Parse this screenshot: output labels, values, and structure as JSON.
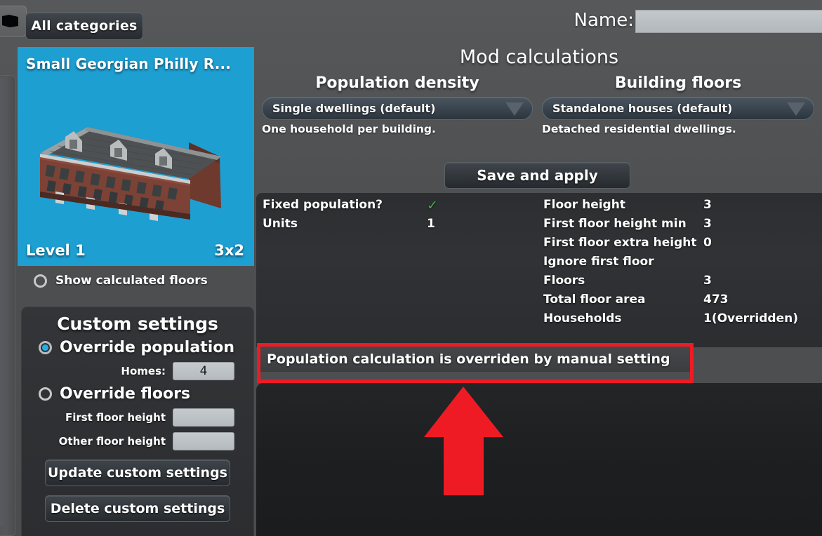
{
  "toolbar": {
    "folder_icon": "folder-icon",
    "all_categories_label": "All categories"
  },
  "name_row": {
    "label": "Name:",
    "value": "",
    "placeholder": ""
  },
  "asset_card": {
    "title": "Small Georgian Philly R...",
    "level": "Level 1",
    "size": "3x2",
    "thumb_bg": "#1e9fd2"
  },
  "show_calculated_floors": {
    "label": "Show calculated floors",
    "selected": false
  },
  "custom_settings": {
    "title": "Custom settings",
    "override_population_label": "Override population",
    "override_population_selected": true,
    "homes_label": "Homes:",
    "homes_value": "4",
    "override_floors_label": "Override floors",
    "override_floors_selected": false,
    "first_floor_height_label": "First floor height",
    "first_floor_height_value": "",
    "other_floor_height_label": "Other floor height",
    "other_floor_height_value": "",
    "update_button": "Update custom settings",
    "delete_button": "Delete custom settings"
  },
  "mod": {
    "title": "Mod calculations",
    "population_density": {
      "heading": "Population density",
      "selected": "Single dwellings (default)",
      "description": "One household per building."
    },
    "building_floors": {
      "heading": "Building floors",
      "selected": "Standalone houses (default)",
      "description": "Detached residential dwellings."
    },
    "save_button": "Save and apply"
  },
  "stats": {
    "left": [
      {
        "key": "Fixed population?",
        "value": "✓",
        "is_check": true
      },
      {
        "key": "Units",
        "value": "1",
        "is_check": false
      }
    ],
    "right": [
      {
        "key": "Floor height",
        "value": "3"
      },
      {
        "key": "First floor height min",
        "value": "3"
      },
      {
        "key": "First floor extra height",
        "value": "0"
      },
      {
        "key": "Ignore first floor",
        "value": ""
      },
      {
        "key": "Floors",
        "value": "3"
      },
      {
        "key": "Total floor area",
        "value": "473"
      },
      {
        "key": "Households",
        "value": "1(Overridden)"
      }
    ]
  },
  "warning": {
    "text": "Population calculation is overriden by manual setting",
    "highlight_color": "#ee1b24"
  },
  "annotation": {
    "arrow": "red-up-arrow",
    "color": "#ee1b24"
  },
  "colors": {
    "accent_blue": "#1e9fd2",
    "radio_fill": "#22b0e8",
    "check_green": "#3fb34f",
    "highlight_red": "#ee1b24"
  }
}
